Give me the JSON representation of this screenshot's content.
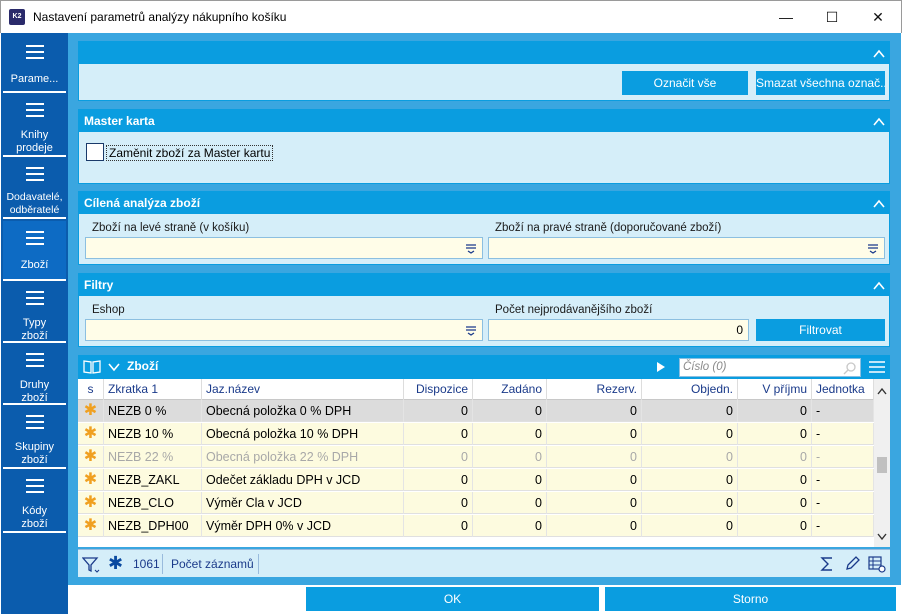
{
  "window": {
    "title": "Nastavení parametrů analýzy nákupního košíku",
    "logo_text": "K2",
    "minimize": "—",
    "maximize": "☐",
    "close": "✕"
  },
  "sidebar": {
    "items": [
      {
        "label": "Parame..."
      },
      {
        "label": "Knihy prodeje"
      },
      {
        "label": "Dodavatelé, odběratelé"
      },
      {
        "label": "Zboží"
      },
      {
        "label": "Typy zboží"
      },
      {
        "label": "Druhy zboží"
      },
      {
        "label": "Skupiny zboží"
      },
      {
        "label": "Kódy zboží"
      }
    ]
  },
  "top_panel": {
    "mark_all": "Označit vše",
    "clear_all": "Smazat všechna označ..."
  },
  "master_panel": {
    "title": "Master karta",
    "checkbox_label": "Zaměnit zboží za Master kartu",
    "checked": false
  },
  "target_panel": {
    "title": "Cílená analýza zboží",
    "left_label": "Zboží na levé straně (v košíku)",
    "left_value": "",
    "right_label": "Zboží na pravé straně (doporučované zboží)",
    "right_value": ""
  },
  "filter_panel": {
    "title": "Filtry",
    "eshop_label": "Eshop",
    "eshop_value": "",
    "count_label": "Počet nejprodávanějšího zboží",
    "count_value": "0",
    "filter_button": "Filtrovat"
  },
  "grid": {
    "title": "Zboží",
    "search_placeholder": "Číslo (0)",
    "columns": [
      "s",
      "Zkratka 1",
      "Jaz.název",
      "Dispozice",
      "Zadáno",
      "Rezerv.",
      "Objedn.",
      "V příjmu",
      "Jednotka"
    ],
    "rows": [
      {
        "s": "✱",
        "code": "NEZB  0 %",
        "name": "Obecná položka  0 % DPH",
        "disp": "0",
        "zad": "0",
        "rez": "0",
        "obj": "0",
        "vpr": "0",
        "jed": "-",
        "dim": false
      },
      {
        "s": "✱",
        "code": "NEZB 10 %",
        "name": "Obecná položka 10 % DPH",
        "disp": "0",
        "zad": "0",
        "rez": "0",
        "obj": "0",
        "vpr": "0",
        "jed": "-",
        "dim": false
      },
      {
        "s": "✱",
        "code": "NEZB 22 %",
        "name": "Obecná položka 22 % DPH",
        "disp": "0",
        "zad": "0",
        "rez": "0",
        "obj": "0",
        "vpr": "0",
        "jed": "-",
        "dim": true
      },
      {
        "s": "✱",
        "code": "NEZB_ZAKL",
        "name": "Odečet základu DPH v JCD",
        "disp": "0",
        "zad": "0",
        "rez": "0",
        "obj": "0",
        "vpr": "0",
        "jed": "-",
        "dim": false
      },
      {
        "s": "✱",
        "code": "NEZB_CLO",
        "name": "Výměr Cla v JCD",
        "disp": "0",
        "zad": "0",
        "rez": "0",
        "obj": "0",
        "vpr": "0",
        "jed": "-",
        "dim": false
      },
      {
        "s": "✱",
        "code": "NEZB_DPH00",
        "name": "Výměr DPH  0% v JCD",
        "disp": "0",
        "zad": "0",
        "rez": "0",
        "obj": "0",
        "vpr": "0",
        "jed": "-",
        "dim": false
      }
    ],
    "footer_count": "1061",
    "footer_label": "Počet záznamů"
  },
  "bottom": {
    "ok": "OK",
    "cancel": "Storno"
  },
  "colors": {
    "accent": "#0a9de0",
    "sidebar": "#0b5cad",
    "panel_bg": "#d5eef9",
    "field_bg": "#fffde8",
    "row_selected": "#dcdcdc",
    "row_yellow": "#fdfbdf",
    "star": "#f0a020"
  }
}
